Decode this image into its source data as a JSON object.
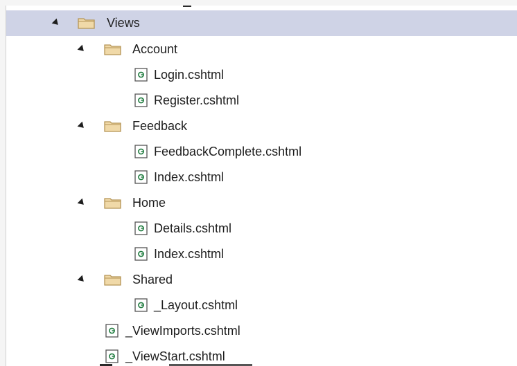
{
  "tree": {
    "root": {
      "label": "Views",
      "icon": "folder-icon",
      "expanded": true,
      "selected": true
    },
    "folders": [
      {
        "label": "Account",
        "icon": "folder-icon",
        "expanded": true,
        "files": [
          {
            "label": "Login.cshtml",
            "icon": "cshtml-file-icon"
          },
          {
            "label": "Register.cshtml",
            "icon": "cshtml-file-icon"
          }
        ]
      },
      {
        "label": "Feedback",
        "icon": "folder-icon",
        "expanded": true,
        "files": [
          {
            "label": "FeedbackComplete.cshtml",
            "icon": "cshtml-file-icon"
          },
          {
            "label": "Index.cshtml",
            "icon": "cshtml-file-icon"
          }
        ]
      },
      {
        "label": "Home",
        "icon": "folder-icon",
        "expanded": true,
        "files": [
          {
            "label": "Details.cshtml",
            "icon": "cshtml-file-icon"
          },
          {
            "label": "Index.cshtml",
            "icon": "cshtml-file-icon"
          }
        ]
      },
      {
        "label": "Shared",
        "icon": "folder-icon",
        "expanded": true,
        "files": [
          {
            "label": "_Layout.cshtml",
            "icon": "cshtml-file-icon"
          }
        ]
      }
    ],
    "root_files": [
      {
        "label": "_ViewImports.cshtml",
        "icon": "cshtml-file-icon"
      },
      {
        "label": "_ViewStart.cshtml",
        "icon": "cshtml-file-icon"
      }
    ]
  },
  "colors": {
    "selection": "#cfd3e6",
    "folder_fill": "#f0d9a8",
    "folder_stroke": "#b59455",
    "file_accent": "#1e7b3e"
  }
}
